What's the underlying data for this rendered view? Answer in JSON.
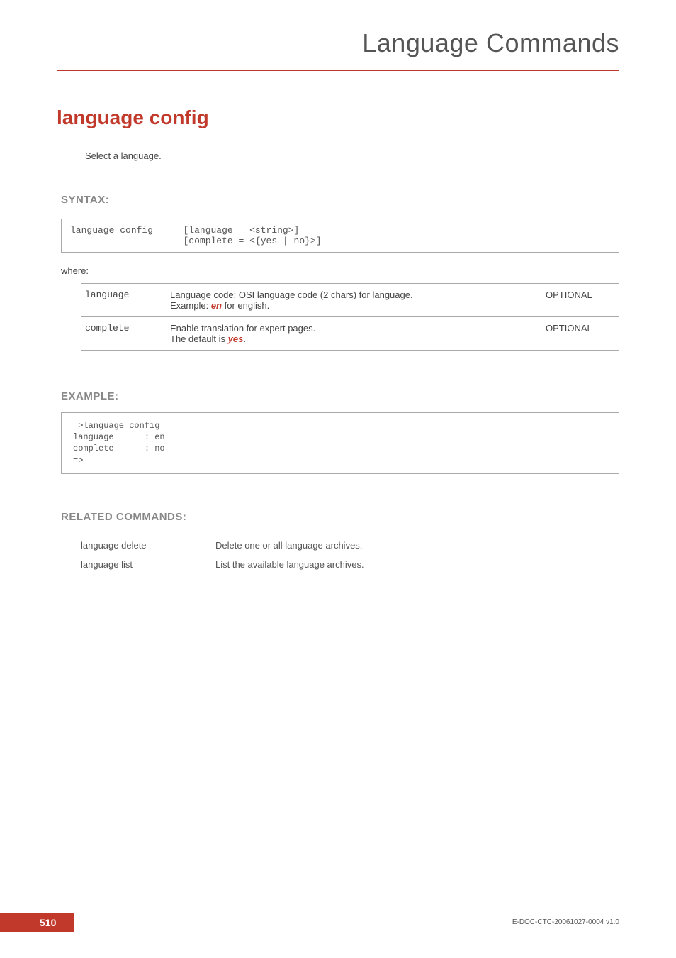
{
  "header": {
    "title": "Language Commands"
  },
  "command": {
    "title": "language config",
    "description": "Select a language."
  },
  "syntax": {
    "label": "SYNTAX:",
    "cmd": "language config",
    "args_line1": "[language = <string>]",
    "args_line2": "[complete = <{yes | no}>]",
    "where_label": "where:",
    "params": [
      {
        "name": "language",
        "desc_pre": "Language code: OSI language code (2 chars) for language.\nExample: ",
        "desc_emph": "en",
        "desc_post": " for english.",
        "flag": "OPTIONAL"
      },
      {
        "name": "complete",
        "desc_pre": "Enable translation for expert pages.\nThe default is ",
        "desc_emph": "yes",
        "desc_post": ".",
        "flag": "OPTIONAL"
      }
    ]
  },
  "example": {
    "label": "EXAMPLE:",
    "text": "=>language config\nlanguage      : en\ncomplete      : no\n=>"
  },
  "related": {
    "label": "RELATED COMMANDS:",
    "items": [
      {
        "name": "language delete",
        "desc": "Delete one or all language archives."
      },
      {
        "name": "language list",
        "desc": "List the available language archives."
      }
    ]
  },
  "footer": {
    "page": "510",
    "doc": "E-DOC-CTC-20061027-0004 v1.0"
  }
}
